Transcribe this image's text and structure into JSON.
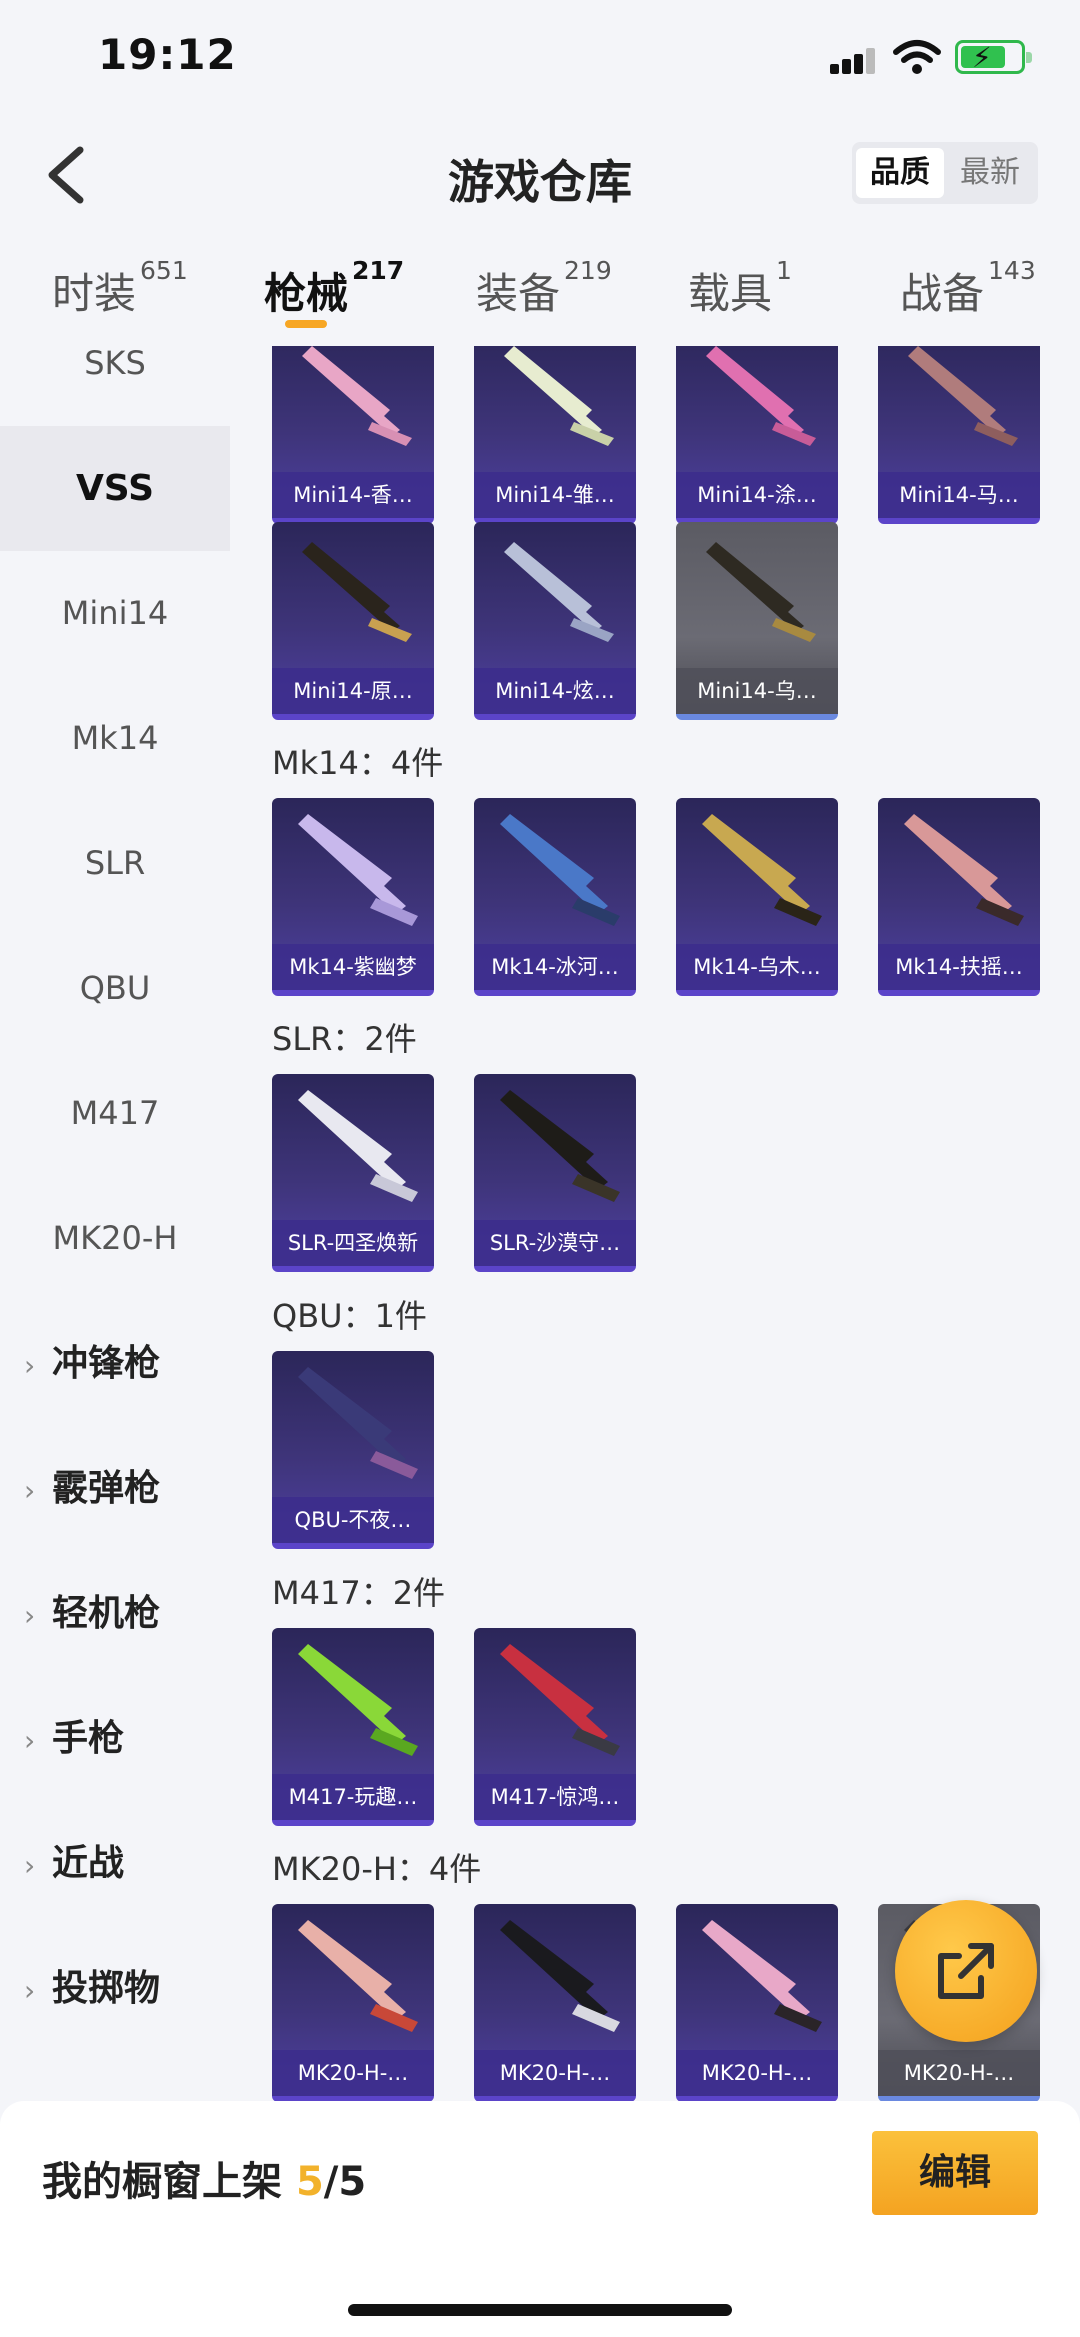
{
  "status": {
    "time": "19:12"
  },
  "header": {
    "title": "游戏仓库",
    "sort_options": [
      "品质",
      "最新"
    ]
  },
  "tabs": [
    {
      "label": "时装",
      "count": "651"
    },
    {
      "label": "枪械",
      "count": "217"
    },
    {
      "label": "装备",
      "count": "219"
    },
    {
      "label": "载具",
      "count": "1"
    },
    {
      "label": "战备",
      "count": "143"
    }
  ],
  "sidebar": {
    "items": [
      "SKS",
      "VSS",
      "Mini14",
      "Mk14",
      "SLR",
      "QBU",
      "M417",
      "MK20-H"
    ],
    "selected": "VSS",
    "categories": [
      "冲锋枪",
      "霰弹枪",
      "轻机枪",
      "手枪",
      "近战",
      "投掷物"
    ]
  },
  "groups": [
    {
      "label": "",
      "items": [
        "Mini14-香…",
        "Mini14-雏…",
        "Mini14-涂…",
        "Mini14-马…",
        "Mini14-原…",
        "Mini14-炫…",
        "Mini14-乌…"
      ]
    },
    {
      "label": "Mk14：4件",
      "items": [
        "Mk14-紫幽梦",
        "Mk14-冰河…",
        "Mk14-乌木…",
        "Mk14-扶摇…"
      ]
    },
    {
      "label": "SLR：2件",
      "items": [
        "SLR-四圣焕新",
        "SLR-沙漠守…"
      ]
    },
    {
      "label": "QBU：1件",
      "items": [
        "QBU-不夜…"
      ]
    },
    {
      "label": "M417：2件",
      "items": [
        "M417-玩趣…",
        "M417-惊鸿…"
      ]
    },
    {
      "label": "MK20-H：4件",
      "items": [
        "MK20-H-…",
        "MK20-H-…",
        "MK20-H-…",
        "MK20-H-…"
      ]
    }
  ],
  "bottom": {
    "shelf_label": "我的橱窗上架",
    "shelf_current": "5",
    "shelf_total": "/5",
    "edit_label": "编辑"
  },
  "colors": {
    "accent": "#f4a321",
    "card_purple": "#3e3479",
    "fab": "#f4a01c"
  }
}
